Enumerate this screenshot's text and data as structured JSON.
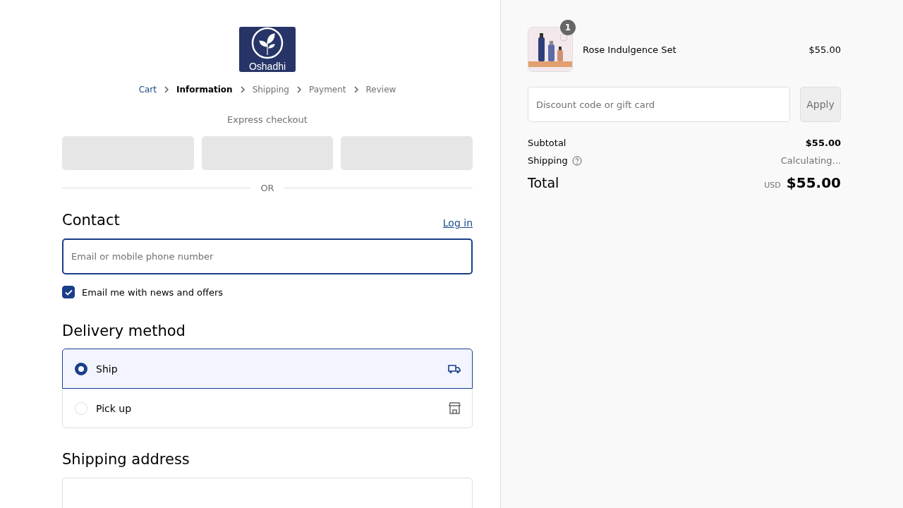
{
  "logo": {
    "text": "Oshadhi"
  },
  "breadcrumbs": [
    {
      "label": "Cart",
      "completed": true,
      "selected": false
    },
    {
      "label": "Information",
      "completed": false,
      "selected": true
    },
    {
      "label": "Shipping",
      "completed": false,
      "selected": false
    },
    {
      "label": "Payment",
      "completed": false,
      "selected": false
    },
    {
      "label": "Review",
      "completed": false,
      "selected": false
    }
  ],
  "express": {
    "title": "Express checkout",
    "divider": "OR"
  },
  "contact": {
    "title": "Contact",
    "login": "Log in",
    "email_placeholder": "Email or mobile phone number",
    "news": {
      "label": "Email me with news and offers",
      "checked": true
    }
  },
  "delivery": {
    "title": "Delivery method",
    "options": [
      {
        "label": "Ship",
        "kind": "truck",
        "selected": true
      },
      {
        "label": "Pick up",
        "kind": "store",
        "selected": false
      }
    ]
  },
  "shipping_address": {
    "title": "Shipping address"
  },
  "summary": {
    "items": [
      {
        "name": "Rose Indulgence Set",
        "price": "$55.00",
        "quantity": "1"
      }
    ],
    "discount_placeholder": "Discount code or gift card",
    "apply": "Apply",
    "subtotal_label": "Subtotal",
    "subtotal": "$55.00",
    "shipping_label": "Shipping",
    "shipping": "Calculating...",
    "total_label": "Total",
    "currency": "USD",
    "total": "$55.00"
  }
}
